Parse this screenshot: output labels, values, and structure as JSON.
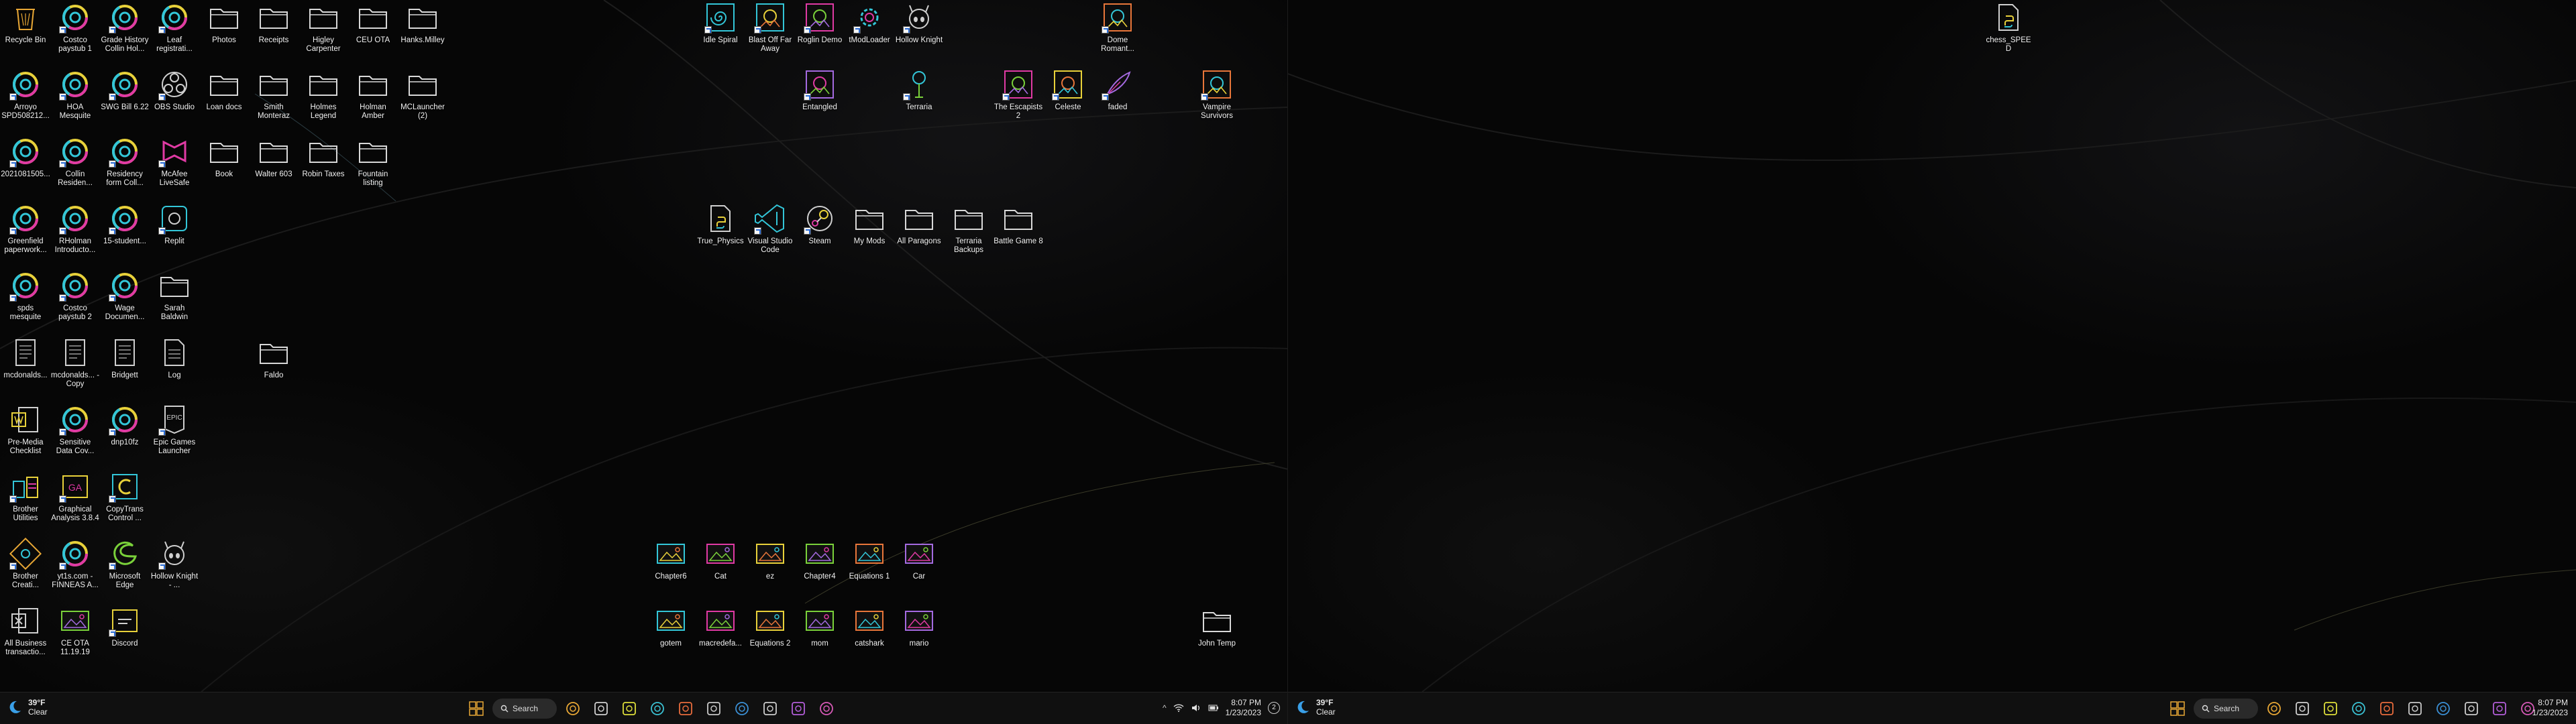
{
  "left_desktop": {
    "icons": [
      {
        "label": "Recycle Bin",
        "icon": "recycle-bin-icon",
        "type": "bin",
        "shortcut": false
      },
      {
        "label": "Costco paystub 1",
        "icon": "chrome-doc-icon",
        "type": "chrome",
        "shortcut": true
      },
      {
        "label": "Grade History Collin Hol...",
        "icon": "chrome-doc-icon",
        "type": "chrome",
        "shortcut": true
      },
      {
        "label": "Leaf registrati...",
        "icon": "chrome-doc-icon",
        "type": "chrome",
        "shortcut": true
      },
      {
        "label": "Photos",
        "icon": "folder-icon",
        "type": "folder",
        "shortcut": false
      },
      {
        "label": "Receipts",
        "icon": "folder-icon",
        "type": "folder",
        "shortcut": false
      },
      {
        "label": "Higley Carpenter",
        "icon": "folder-icon",
        "type": "folder",
        "shortcut": false
      },
      {
        "label": "CEU OTA",
        "icon": "folder-icon",
        "type": "folder",
        "shortcut": false
      },
      {
        "label": "Hanks.Milley",
        "icon": "folder-icon",
        "type": "folder",
        "shortcut": false
      },
      {
        "label": "Arroyo SPD508212...",
        "icon": "chrome-doc-icon",
        "type": "chrome",
        "shortcut": true
      },
      {
        "label": "HOA Mesquite",
        "icon": "chrome-doc-icon",
        "type": "chrome",
        "shortcut": true
      },
      {
        "label": "SWG Bill 6.22",
        "icon": "chrome-doc-icon",
        "type": "chrome",
        "shortcut": true
      },
      {
        "label": "OBS Studio",
        "icon": "obs-icon",
        "type": "obs",
        "shortcut": true
      },
      {
        "label": "Loan docs",
        "icon": "folder-icon",
        "type": "folder",
        "shortcut": false
      },
      {
        "label": "Smith Monteraz",
        "icon": "folder-icon",
        "type": "folder",
        "shortcut": false
      },
      {
        "label": "Holmes Legend",
        "icon": "folder-icon",
        "type": "folder",
        "shortcut": false
      },
      {
        "label": "Holman Amber",
        "icon": "folder-icon",
        "type": "folder",
        "shortcut": false
      },
      {
        "label": "MCLauncher (2)",
        "icon": "folder-icon",
        "type": "folder",
        "shortcut": false
      },
      {
        "label": "2021081505...",
        "icon": "chrome-doc-icon",
        "type": "chrome",
        "shortcut": true
      },
      {
        "label": "Collin Residen...",
        "icon": "chrome-doc-icon",
        "type": "chrome",
        "shortcut": true
      },
      {
        "label": "Residency form Coll...",
        "icon": "chrome-doc-icon",
        "type": "chrome",
        "shortcut": true
      },
      {
        "label": "McAfee LiveSafe",
        "icon": "mcafee-icon",
        "type": "mcafee",
        "shortcut": true
      },
      {
        "label": "Book",
        "icon": "folder-icon",
        "type": "folder",
        "shortcut": false
      },
      {
        "label": "Walter 603",
        "icon": "folder-icon",
        "type": "folder",
        "shortcut": false
      },
      {
        "label": "Robin Taxes",
        "icon": "folder-icon",
        "type": "folder",
        "shortcut": false
      },
      {
        "label": "Fountain listing",
        "icon": "folder-icon",
        "type": "folder",
        "shortcut": false
      },
      {
        "label": "Greenfield paperwork...",
        "icon": "chrome-doc-icon",
        "type": "chrome",
        "shortcut": true
      },
      {
        "label": "RHolman Introducto...",
        "icon": "chrome-doc-icon",
        "type": "chrome",
        "shortcut": true
      },
      {
        "label": "15-student...",
        "icon": "chrome-doc-icon",
        "type": "chrome",
        "shortcut": true
      },
      {
        "label": "Replit",
        "icon": "replit-icon",
        "type": "replit",
        "shortcut": true
      },
      {
        "label": "spds mesquite",
        "icon": "chrome-doc-icon",
        "type": "chrome",
        "shortcut": true
      },
      {
        "label": "Costco paystub 2",
        "icon": "chrome-doc-icon",
        "type": "chrome",
        "shortcut": true
      },
      {
        "label": "Wage Documen...",
        "icon": "chrome-doc-icon",
        "type": "chrome",
        "shortcut": true
      },
      {
        "label": "Sarah Baldwin",
        "icon": "folder-icon",
        "type": "folder",
        "shortcut": false
      },
      {
        "label": "mcdonalds...",
        "icon": "document-icon",
        "type": "doc",
        "shortcut": false
      },
      {
        "label": "mcdonalds... - Copy",
        "icon": "document-icon",
        "type": "doc",
        "shortcut": false
      },
      {
        "label": "Bridgett",
        "icon": "document-icon",
        "type": "doc",
        "shortcut": false
      },
      {
        "label": "Log",
        "icon": "text-file-icon",
        "type": "txt",
        "shortcut": false
      },
      {
        "label": "Faldo",
        "icon": "folder-icon",
        "type": "folder",
        "shortcut": false
      },
      {
        "label": "Pre-Media Checklist",
        "icon": "word-doc-icon",
        "type": "word",
        "shortcut": false
      },
      {
        "label": "Sensitive Data Cov...",
        "icon": "chrome-doc-icon",
        "type": "chrome",
        "shortcut": true
      },
      {
        "label": "dnp10fz",
        "icon": "chrome-doc-icon",
        "type": "chrome",
        "shortcut": true
      },
      {
        "label": "Epic Games Launcher",
        "icon": "epic-games-icon",
        "type": "epic",
        "shortcut": true
      },
      {
        "label": "Brother Utilities",
        "icon": "brother-utilities-icon",
        "type": "brother",
        "shortcut": true
      },
      {
        "label": "Graphical Analysis 3.8.4",
        "icon": "graphical-analysis-icon",
        "type": "ga",
        "shortcut": true
      },
      {
        "label": "CopyTrans Control ...",
        "icon": "copytrans-icon",
        "type": "copytrans",
        "shortcut": true
      },
      {
        "label": "Brother Creati...",
        "icon": "brother-creative-icon",
        "type": "brother2",
        "shortcut": true
      },
      {
        "label": "yt1s.com - FINNEAS A...",
        "icon": "chrome-doc-icon",
        "type": "chrome",
        "shortcut": true
      },
      {
        "label": "Microsoft Edge",
        "icon": "edge-icon",
        "type": "edge",
        "shortcut": true
      },
      {
        "label": "Hollow Knight - ...",
        "icon": "hollow-knight-icon",
        "type": "hk",
        "shortcut": true
      },
      {
        "label": "All Business transactio...",
        "icon": "excel-icon",
        "type": "excel",
        "shortcut": false
      },
      {
        "label": "CE OTA 11.19.19",
        "icon": "image-file-icon",
        "type": "img",
        "shortcut": false
      },
      {
        "label": "Discord",
        "icon": "discord-icon",
        "type": "discord",
        "shortcut": true
      },
      {
        "label": "Idle Spiral",
        "icon": "idle-spiral-icon",
        "type": "spiral",
        "shortcut": true
      },
      {
        "label": "Blast Off Far Away",
        "icon": "blast-off-icon",
        "type": "game",
        "shortcut": true
      },
      {
        "label": "Roglin Demo",
        "icon": "roglin-icon",
        "type": "game",
        "shortcut": true
      },
      {
        "label": "tModLoader",
        "icon": "tmodloader-icon",
        "type": "gear",
        "shortcut": true
      },
      {
        "label": "Hollow Knight",
        "icon": "hollow-knight-icon",
        "type": "hk",
        "shortcut": true
      },
      {
        "label": "Dome Romant...",
        "icon": "dome-romantik-icon",
        "type": "game",
        "shortcut": true
      },
      {
        "label": "Entangled",
        "icon": "entangled-icon",
        "type": "game",
        "shortcut": true
      },
      {
        "label": "Terraria",
        "icon": "terraria-icon",
        "type": "tree",
        "shortcut": true
      },
      {
        "label": "The Escapists 2",
        "icon": "escapists-icon",
        "type": "game",
        "shortcut": true
      },
      {
        "label": "Celeste",
        "icon": "celeste-icon",
        "type": "game",
        "shortcut": true
      },
      {
        "label": "faded",
        "icon": "faded-icon",
        "type": "feather",
        "shortcut": true
      },
      {
        "label": "Vampire Survivors",
        "icon": "vampire-survivors-icon",
        "type": "game",
        "shortcut": true
      },
      {
        "label": "True_Physics",
        "icon": "python-file-icon",
        "type": "py",
        "shortcut": false
      },
      {
        "label": "Visual Studio Code",
        "icon": "vscode-icon",
        "type": "vscode",
        "shortcut": true
      },
      {
        "label": "Steam",
        "icon": "steam-icon",
        "type": "steam",
        "shortcut": true
      },
      {
        "label": "My Mods",
        "icon": "folder-icon",
        "type": "folder",
        "shortcut": false
      },
      {
        "label": "All Paragons",
        "icon": "folder-icon",
        "type": "folder",
        "shortcut": false
      },
      {
        "label": "Terraria Backups",
        "icon": "folder-icon",
        "type": "folder",
        "shortcut": false
      },
      {
        "label": "Battle Game 8",
        "icon": "folder-icon",
        "type": "folder",
        "shortcut": false
      },
      {
        "label": "Chapter6",
        "icon": "image-file-icon",
        "type": "img",
        "shortcut": false
      },
      {
        "label": "Cat",
        "icon": "image-file-icon",
        "type": "img",
        "shortcut": false
      },
      {
        "label": "ez",
        "icon": "image-file-icon",
        "type": "img",
        "shortcut": false
      },
      {
        "label": "Chapter4",
        "icon": "image-file-icon",
        "type": "img",
        "shortcut": false
      },
      {
        "label": "Equations 1",
        "icon": "image-file-icon",
        "type": "img",
        "shortcut": false
      },
      {
        "label": "Car",
        "icon": "image-file-icon",
        "type": "img",
        "shortcut": false
      },
      {
        "label": "gotem",
        "icon": "image-file-icon",
        "type": "img",
        "shortcut": false
      },
      {
        "label": "macredefa...",
        "icon": "image-file-icon",
        "type": "img",
        "shortcut": false
      },
      {
        "label": "Equations 2",
        "icon": "image-file-icon",
        "type": "img",
        "shortcut": false
      },
      {
        "label": "mom",
        "icon": "image-file-icon",
        "type": "img",
        "shortcut": false
      },
      {
        "label": "catshark",
        "icon": "image-file-icon",
        "type": "img",
        "shortcut": false
      },
      {
        "label": "mario",
        "icon": "image-file-icon",
        "type": "img",
        "shortcut": false
      },
      {
        "label": "John Temp",
        "icon": "folder-icon",
        "type": "folder",
        "shortcut": false
      }
    ]
  },
  "right_desktop": {
    "icons": [
      {
        "label": "chess_SPEED",
        "icon": "python-file-icon",
        "type": "py",
        "shortcut": false
      }
    ]
  },
  "taskbar": {
    "weather_temp": "39°F",
    "weather_desc": "Clear",
    "search_label": "Search",
    "time": "8:07 PM",
    "date": "1/23/2023",
    "notification_count": "2",
    "pinned_apps": [
      {
        "name": "file-explorer-icon",
        "color": "#e8a735"
      },
      {
        "name": "task-view-icon",
        "color": "#cfcfcf"
      },
      {
        "name": "chrome-icon",
        "color": "#dede3a"
      },
      {
        "name": "edge-taskbar-icon",
        "color": "#3bc2d4"
      },
      {
        "name": "firefox-icon",
        "color": "#e86b3c"
      },
      {
        "name": "steam-taskbar-icon",
        "color": "#c8c8c8"
      },
      {
        "name": "vscode-taskbar-icon",
        "color": "#3b8fd4"
      },
      {
        "name": "obs-taskbar-icon",
        "color": "#cccccc"
      },
      {
        "name": "discord-taskbar-icon",
        "color": "#b25dd8"
      },
      {
        "name": "mail-icon",
        "color": "#d85ab8"
      }
    ]
  },
  "colors": {
    "accent_cyan": "#33c6d8",
    "accent_pink": "#e03aa4",
    "accent_yellow": "#e8d13a",
    "shortcut_arrow": "#2a6cd6",
    "taskbar_bg": "#101010"
  }
}
